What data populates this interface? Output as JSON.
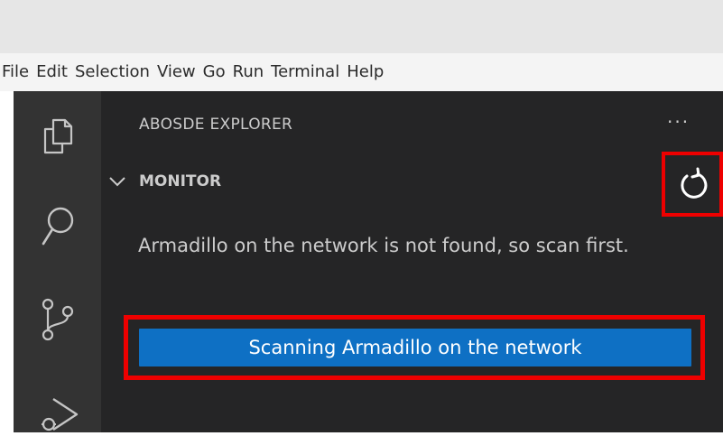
{
  "menu": [
    "File",
    "Edit",
    "Selection",
    "View",
    "Go",
    "Run",
    "Terminal",
    "Help"
  ],
  "activity_bar": {
    "icons": [
      "explorer-icon",
      "search-icon",
      "source-control-icon",
      "run-debug-icon"
    ]
  },
  "sidebar": {
    "view_title": "ABOSDE EXPLORER",
    "more_label": "···",
    "section": {
      "title": "MONITOR",
      "collapse_icon": "chevron-down-icon",
      "action_icon": "refresh-icon"
    },
    "message": "Armadillo on the network is not found, so scan first.",
    "scan_button_label": "Scanning Armadillo on the network"
  },
  "colors": {
    "activity_bar_bg": "#333333",
    "sidebar_bg": "#252526",
    "button_bg": "#0e70c4",
    "highlight_border": "#ee0000",
    "menubar_bg": "#f4f4f4",
    "titlebar_bg": "#e6e6e6"
  }
}
